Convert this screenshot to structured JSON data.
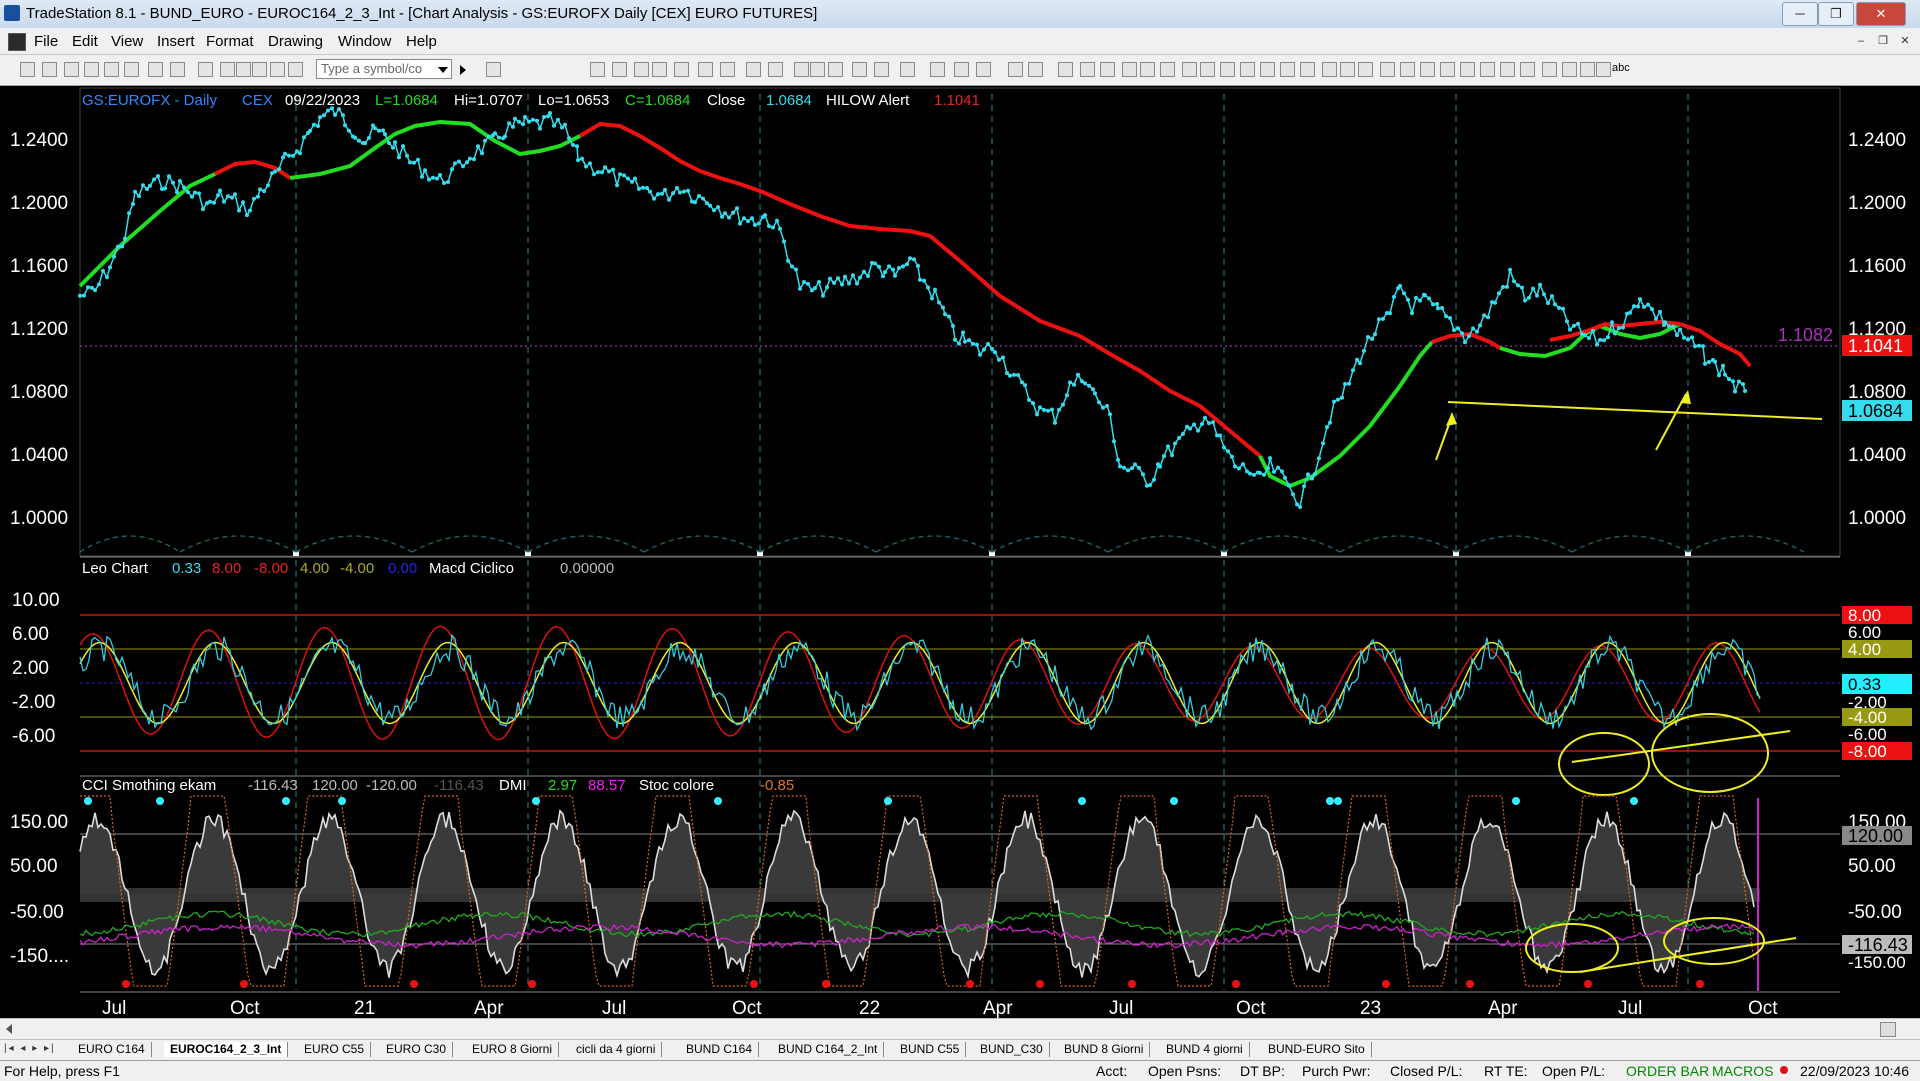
{
  "window": {
    "title": "TradeStation 8.1 - BUND_EURO - EUROC164_2_3_Int - [Chart Analysis - GS:EUROFX  Daily  [CEX] EURO FUTURES]",
    "minimize": "─",
    "maximize": "❐",
    "close": "✕"
  },
  "menu": [
    "File",
    "Edit",
    "View",
    "Insert",
    "Format",
    "Drawing",
    "Window",
    "Help"
  ],
  "mdi": {
    "minimize": "–",
    "restore": "❐",
    "close": "✕"
  },
  "toolbar": {
    "symbol_placeholder": "Type a symbol/co",
    "abc": "abc"
  },
  "panel1": {
    "symbol": "GS:EUROFX - Daily",
    "exchange": "CEX",
    "date": "09/22/2023",
    "last": "L=1.0684",
    "high": "Hi=1.0707",
    "low": "Lo=1.0653",
    "close": "C=1.0684",
    "close_label": "Close",
    "close_val": "1.0684",
    "hilow_label": "HILOW Alert",
    "hilow_val": "1.1041",
    "y_ticks": [
      "1.2400",
      "1.2000",
      "1.1600",
      "1.1200",
      "1.0800",
      "1.0400",
      "1.0000"
    ],
    "level_text": "1.1082",
    "red_tag": "1.1041",
    "cyan_tag": "1.0684"
  },
  "panel2": {
    "name": "Leo Chart",
    "v1": "0.33",
    "v2": "8.00",
    "v3": "-8.00",
    "v4": "4.00",
    "v5": "-4.00",
    "v6": "0.00",
    "name2": "Macd Ciclico",
    "v7": "0.00000",
    "y_ticks": [
      "10.00",
      "6.00",
      "2.00",
      "-2.00",
      "-6.00"
    ],
    "tag_8": "8.00",
    "tag_6": "6.00",
    "tag_4": "4.00",
    "tag_033": "0.33",
    "tag_m2": "-2.00",
    "tag_m4": "-4.00",
    "tag_m6": "-6.00",
    "tag_m8": "-8.00"
  },
  "panel3": {
    "name": "CCI Smothing ekam",
    "v1": "-116.43",
    "v2": "120.00",
    "v3": "-120.00",
    "v4": "-116.43",
    "name2": "DMI",
    "v5": "2.97",
    "v6": "88.57",
    "name3": "Stoc colore",
    "v7": "-0.85",
    "y_ticks": [
      "150.00",
      "50.00",
      "-50.00",
      "-150...."
    ],
    "tag_150": "150.00",
    "tag_120": "120.00",
    "tag_50": "50.00",
    "tag_m50": "-50.00",
    "tag_m116": "-116.43",
    "tag_m150": "-150.00"
  },
  "x_axis": [
    "Jul",
    "Oct",
    "21",
    "Apr",
    "Jul",
    "Oct",
    "22",
    "Apr",
    "Jul",
    "Oct",
    "23",
    "Apr",
    "Jul",
    "Oct"
  ],
  "tabs": [
    "EURO C164",
    "EUROC164_2_3_Int",
    "EURO C55",
    "EURO C30",
    "EURO 8 Giorni",
    "cicli da 4 giorni",
    "BUND C164",
    "BUND C164_2_Int",
    "BUND C55",
    "BUND_C30",
    "BUND 8 Giorni",
    "BUND 4 giorni",
    "BUND-EURO Sito"
  ],
  "status": {
    "help": "For Help, press F1",
    "acct": "Acct:",
    "open_psns": "Open Psns:",
    "dt_bp": "DT BP:",
    "purch_pwr": "Purch Pwr:",
    "closed_pl": "Closed P/L:",
    "rt_te": "RT TE:",
    "open_pl": "Open P/L:",
    "order_bar": "ORDER BAR",
    "macros": "MACROS",
    "datetime": "22/09/2023 10:46"
  },
  "colors": {
    "cyan": "#33ddee",
    "red": "#ee1111",
    "green": "#22dd22",
    "yellow": "#eeee22",
    "grid": "#1e6a6a"
  }
}
